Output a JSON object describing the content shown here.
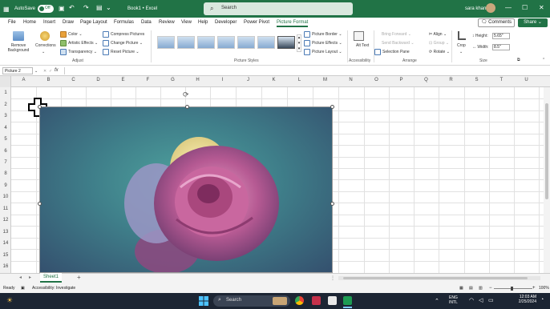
{
  "titlebar": {
    "autosave": "AutoSave",
    "autosave_state": "Off",
    "filename": "Book1",
    "app": "Excel",
    "search_placeholder": "Search",
    "user": "sara khan"
  },
  "menu": {
    "items": [
      "File",
      "Home",
      "Insert",
      "Draw",
      "Page Layout",
      "Formulas",
      "Data",
      "Review",
      "View",
      "Help",
      "Developer",
      "Power Pivot",
      "Picture Format"
    ],
    "active": "Picture Format",
    "comments": "Comments",
    "share": "Share"
  },
  "ribbon": {
    "remove_background": "Remove Background",
    "corrections": "Corrections",
    "color": "Color",
    "artistic_effects": "Artistic Effects",
    "transparency": "Transparency",
    "compress_pictures": "Compress Pictures",
    "change_picture": "Change Picture",
    "reset_picture": "Reset Picture",
    "group_adjust": "Adjust",
    "group_picture_styles": "Picture Styles",
    "picture_border": "Picture Border",
    "picture_effects": "Picture Effects",
    "picture_layout": "Picture Layout",
    "alt_text": "Alt Text",
    "group_accessibility": "Accessibility",
    "bring_forward": "Bring Forward",
    "send_backward": "Send Backward",
    "selection_pane": "Selection Pane",
    "align": "Align",
    "group": "Group",
    "rotate": "Rotate",
    "group_arrange": "Arrange",
    "crop": "Crop",
    "height_label": "Height:",
    "height_value": "5.65\"",
    "width_label": "Width:",
    "width_value": "8.5\"",
    "group_size": "Size"
  },
  "formula_bar": {
    "name_box": "Picture 2",
    "fx": "fx"
  },
  "grid": {
    "columns": [
      "A",
      "B",
      "C",
      "D",
      "E",
      "F",
      "G",
      "H",
      "I",
      "J",
      "K",
      "L",
      "M",
      "N",
      "O",
      "P",
      "Q",
      "R",
      "S",
      "T",
      "U"
    ],
    "rows": [
      "1",
      "2",
      "3",
      "4",
      "5",
      "6",
      "7",
      "8",
      "9",
      "10",
      "11",
      "12",
      "13",
      "14",
      "15",
      "16"
    ]
  },
  "sheets": {
    "tab": "Sheet1",
    "add": "+"
  },
  "status": {
    "ready": "Ready",
    "accessibility": "Accessibility: Investigate",
    "zoom": "100%"
  },
  "taskbar": {
    "search": "Search",
    "lang1": "ENG",
    "lang2": "INTL",
    "time": "12:03 AM",
    "date": "2/25/2024"
  },
  "colors": {
    "accent": "#217346",
    "taskbar": "#1c2533"
  }
}
